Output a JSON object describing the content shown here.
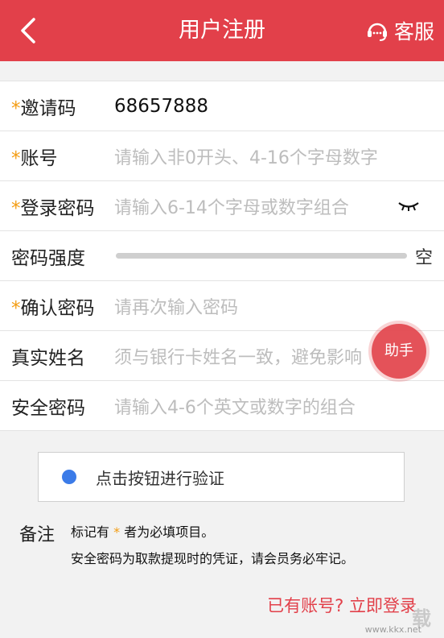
{
  "header": {
    "title": "用户注册",
    "service_label": "客服"
  },
  "form": {
    "invite": {
      "label": "邀请码",
      "value": "68657888"
    },
    "account": {
      "label": "账号",
      "placeholder": "请输入非0开头、4-16个字母数字"
    },
    "password": {
      "label": "登录密码",
      "placeholder": "请输入6-14个字母或数字组合"
    },
    "strength": {
      "label": "密码强度",
      "value_text": "空",
      "level": 0
    },
    "confirm": {
      "label": "确认密码",
      "placeholder": "请再次输入密码"
    },
    "realname": {
      "label": "真实姓名",
      "placeholder": "须与银行卡姓名一致，避免影响"
    },
    "safepwd": {
      "label": "安全密码",
      "placeholder": "请输入4-6个英文或数字的组合"
    },
    "required_mark": "*"
  },
  "helper_label": "助手",
  "verify_label": "点击按钮进行验证",
  "note": {
    "label": "备注",
    "line1_prefix": "标记有",
    "line1_star": "*",
    "line1_suffix": "者为必填项目。",
    "line2": "安全密码为取款提现时的凭证，请会员务必牢记。"
  },
  "login_link": "已有账号? 立即登录",
  "watermark": {
    "text": "载",
    "url": "www.kkx.net"
  },
  "colors": {
    "brand": "#e2404a",
    "required": "#f39c12",
    "verify_dot": "#3b7be8"
  }
}
